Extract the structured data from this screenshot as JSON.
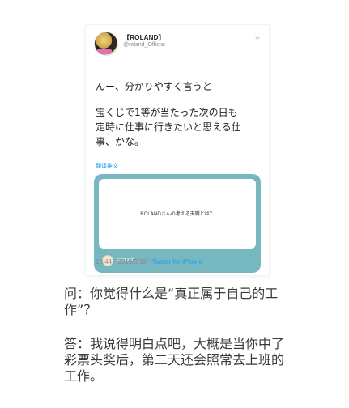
{
  "tweet": {
    "author_name": "【ROLAND】",
    "author_handle": "@roland_Official",
    "line1": "んー、分かりやすく言うと",
    "body": "宝くじで1等が当たった次の日も\n定時に仕事に行きたいと思える仕\n事、かな。",
    "translate_label": "翻译推文",
    "media_caption": "ROLANDさんの考える天職とは？",
    "media_source": "porg.xot",
    "timestamp": "18:44 · 2019/5/19 · ",
    "via": "Twitter for iPhone"
  },
  "qa": {
    "question": "问：你觉得什么是“真正属于自己的工\n作”？",
    "answer": "答：我说得明白点吧，大概是当你中了\n彩票头奖后，第二天还会照常去上班的\n工作。"
  },
  "colors": {
    "link_blue": "#1da1f2",
    "media_teal": "#77b7bf"
  },
  "icons": {
    "avatar": "profile-avatar",
    "chevron": "chevron-down-icon"
  }
}
